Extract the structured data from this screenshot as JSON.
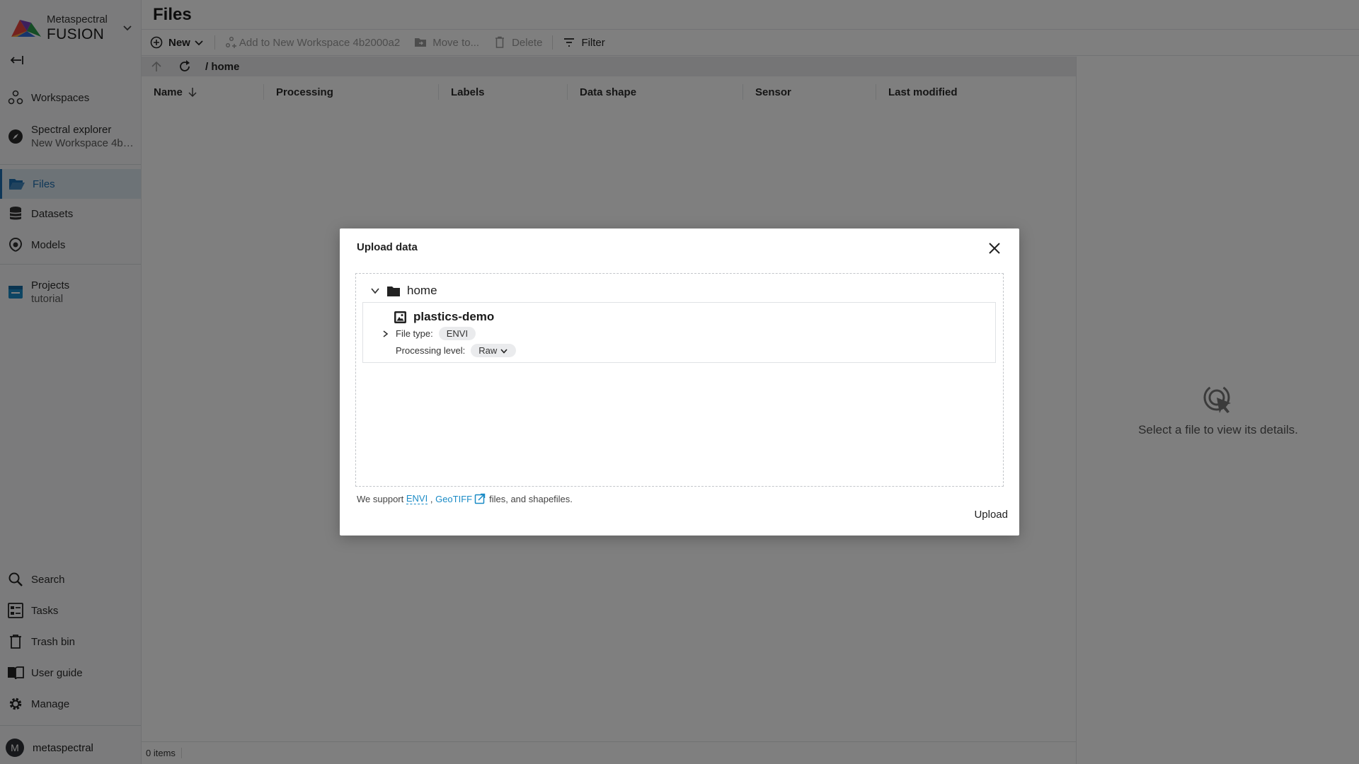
{
  "brand": {
    "subtitle": "Metaspectral",
    "name": "FUSION"
  },
  "sidebar": {
    "items": [
      {
        "label": "Workspaces",
        "icon": "workspaces-icon"
      },
      {
        "label": "Spectral explorer",
        "sub": "New Workspace 4b…",
        "icon": "compass-icon"
      },
      {
        "label": "Files",
        "icon": "folder-open-icon",
        "active": true
      },
      {
        "label": "Datasets",
        "icon": "database-icon"
      },
      {
        "label": "Models",
        "icon": "models-icon"
      },
      {
        "label": "Projects",
        "sub": "tutorial",
        "icon": "project-icon"
      }
    ],
    "bottom_items": [
      {
        "label": "Search",
        "icon": "search-icon"
      },
      {
        "label": "Tasks",
        "icon": "tasks-icon"
      },
      {
        "label": "Trash bin",
        "icon": "trash-icon"
      },
      {
        "label": "User guide",
        "icon": "book-icon"
      },
      {
        "label": "Manage",
        "icon": "gear-icon"
      }
    ],
    "user": {
      "initial": "M",
      "name": "metaspectral"
    }
  },
  "main": {
    "title": "Files",
    "toolbar": {
      "new_label": "New",
      "add_label": "Add to New Workspace 4b2000a2",
      "move_label": "Move to...",
      "delete_label": "Delete",
      "filter_label": "Filter"
    },
    "path": "/ home",
    "columns": [
      "Name",
      "Processing",
      "Labels",
      "Data shape",
      "Sensor",
      "Last modified"
    ],
    "status": "0 items",
    "details_placeholder": "Select a file to view its details."
  },
  "modal": {
    "title": "Upload data",
    "folder": "home",
    "file": {
      "name": "plastics-demo",
      "file_type_label": "File type:",
      "file_type": "ENVI",
      "processing_label": "Processing level:",
      "processing_level": "Raw"
    },
    "support": {
      "prefix": "We support",
      "envi": "ENVI",
      "comma": ",",
      "geotiff": "GeoTIFF",
      "suffix": "files, and shapefiles."
    },
    "upload_label": "Upload"
  },
  "colors": {
    "accent": "#1d6fb0",
    "link": "#1a8bc6",
    "active_bg": "#dbe6ee"
  }
}
